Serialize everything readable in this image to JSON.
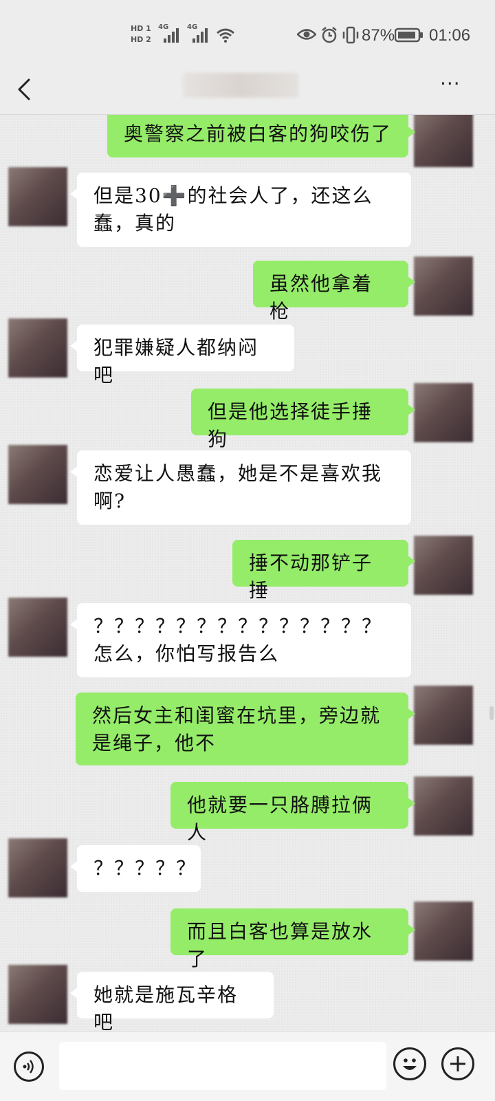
{
  "status_bar": {
    "hd1": "HD 1",
    "hd2": "HD 2",
    "sig1": "4G",
    "sig2": "4G",
    "battery_percent": "87%",
    "time": "01:06"
  },
  "nav": {
    "back_icon": "chevron-left-icon",
    "more_icon": "ellipsis-icon",
    "more_label": "···"
  },
  "messages": [
    {
      "sender": "me",
      "text": "奥警察之前被白客的狗咬伤了"
    },
    {
      "sender": "other",
      "text": "但是30➕的社会人了，还这么蠢，真的"
    },
    {
      "sender": "me",
      "text": "虽然他拿着枪"
    },
    {
      "sender": "other",
      "text": "犯罪嫌疑人都纳闷吧"
    },
    {
      "sender": "me",
      "text": "但是他选择徒手捶狗"
    },
    {
      "sender": "other",
      "text": "恋爱让人愚蠢，她是不是喜欢我啊?"
    },
    {
      "sender": "me",
      "text": "捶不动那铲子捶"
    },
    {
      "sender": "other",
      "text": "？？？？？？？？？？？？？？怎么，你怕写报告么"
    },
    {
      "sender": "me",
      "text": "然后女主和闺蜜在坑里，旁边就是绳子，他不"
    },
    {
      "sender": "me",
      "text": "他就要一只胳膊拉俩人"
    },
    {
      "sender": "other",
      "text": "？？？？？"
    },
    {
      "sender": "me",
      "text": "而且白客也算是放水了"
    },
    {
      "sender": "other",
      "text": "她就是施瓦辛格吧"
    }
  ],
  "input_bar": {
    "voice_icon": "voice-icon",
    "emoji_icon": "emoji-icon",
    "plus_icon": "plus-icon",
    "input_value": ""
  },
  "colors": {
    "my_bubble": "#95ec69",
    "other_bubble": "#ffffff",
    "background": "#ededed"
  }
}
